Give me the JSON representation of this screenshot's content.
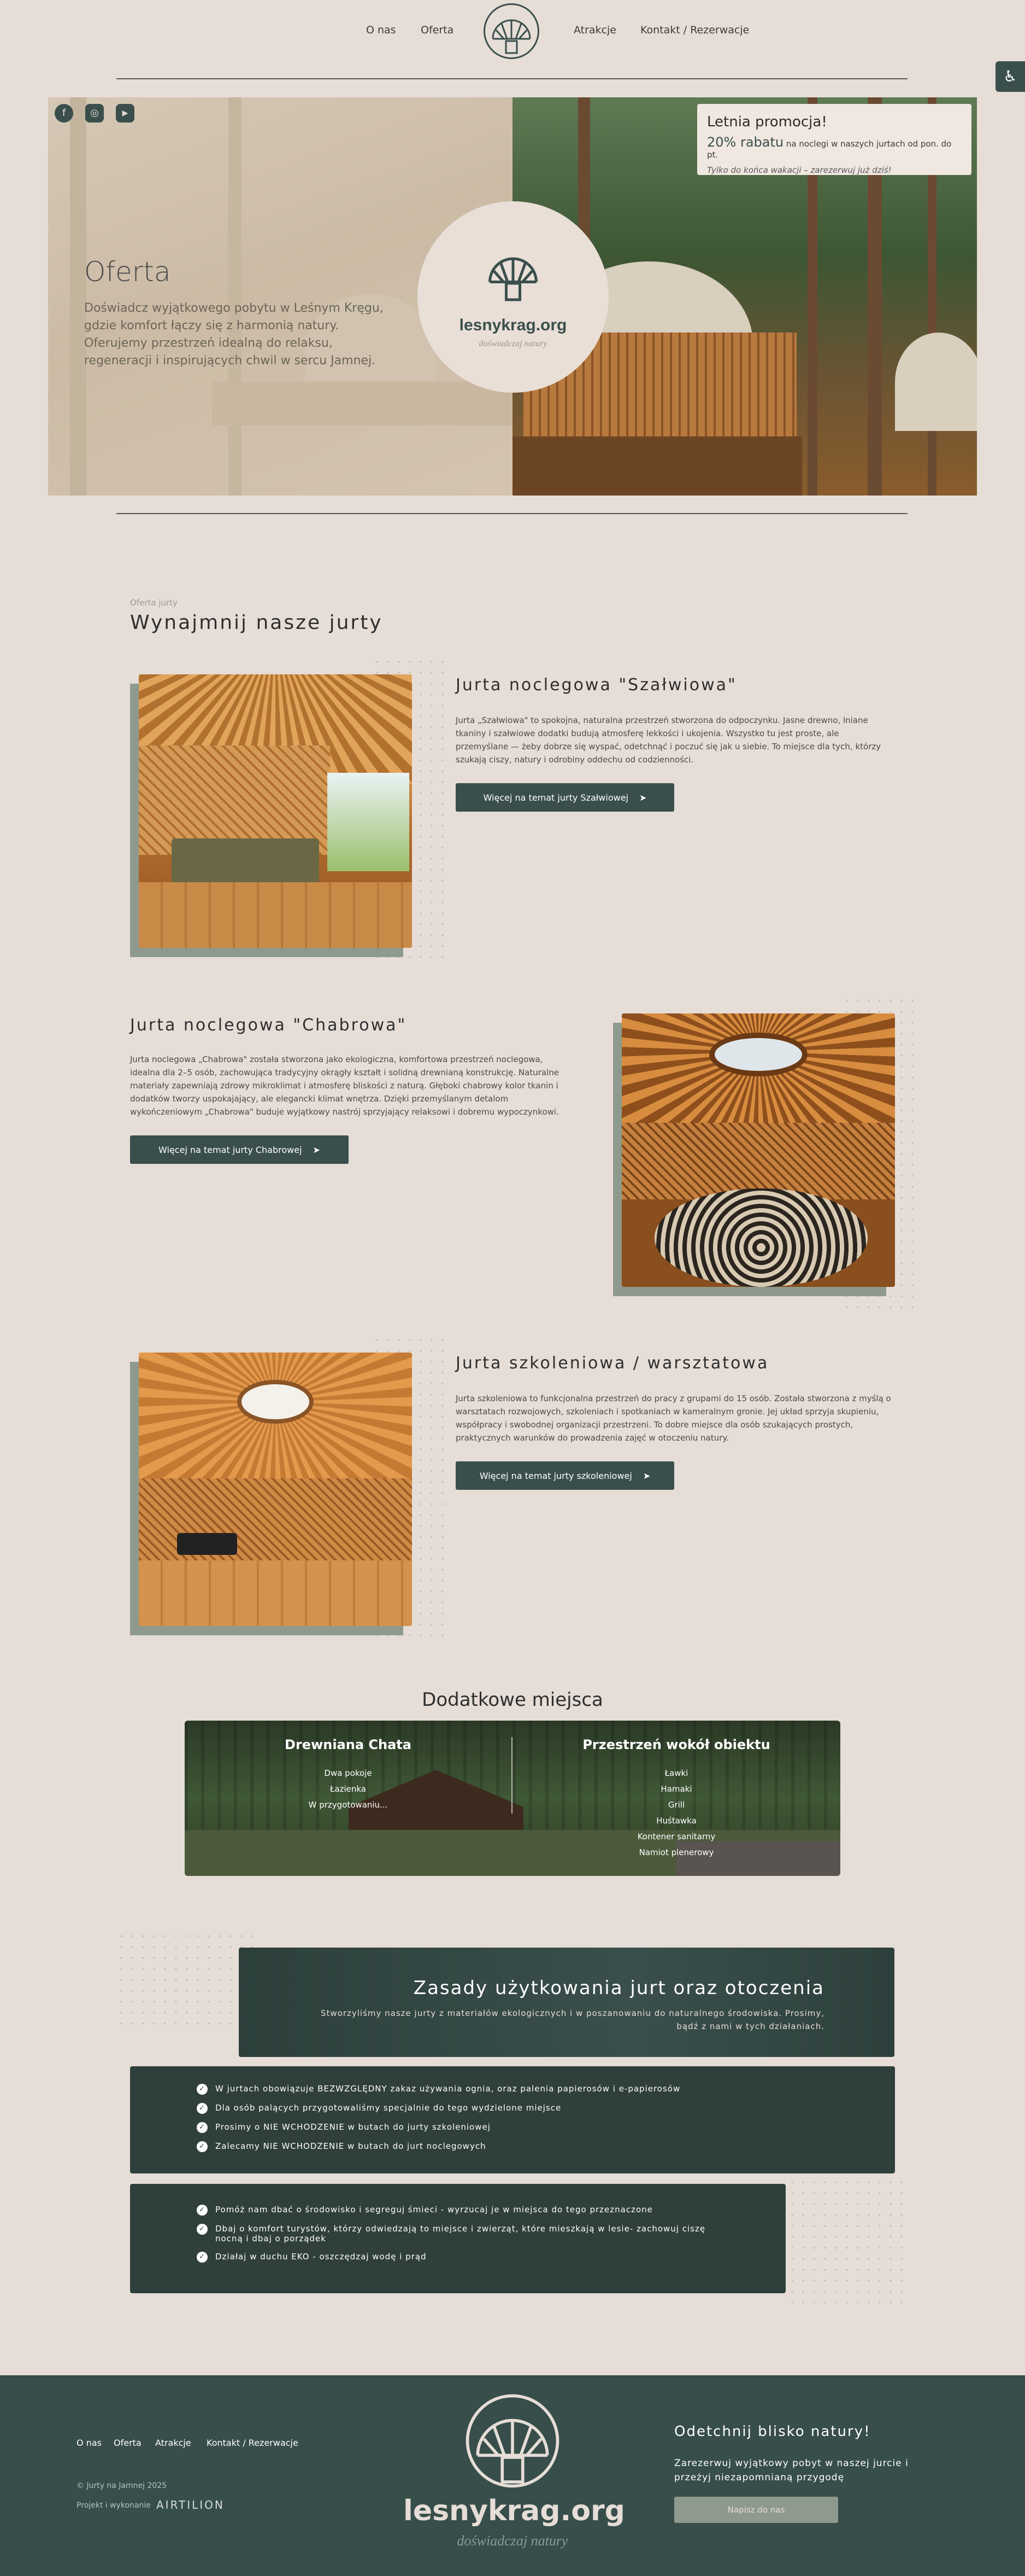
{
  "nav": {
    "items": [
      "O nas",
      "Oferta",
      "Atrakcje",
      "Kontakt / Rezerwacje"
    ]
  },
  "hero": {
    "title": "Oferta",
    "text": "Doświadcz wyjątkowego pobytu w Leśnym Kręgu, gdzie komfort łączy się z harmonią natury. Oferujemy przestrzeń idealną do relaksu, regeneracji i inspirujących chwil w sercu Jamnej.",
    "logo_name": "lesnykrag.org",
    "logo_tag": "doświadczaj natury",
    "promo": {
      "title": "Letnia promocja!",
      "highlight": "20% rabatu",
      "rest": " na noclegi w naszych jurtach od pon. do pt.",
      "note": "Tylko do końca wakacji – zarezerwuj już dziś!"
    }
  },
  "offer": {
    "eyebrow": "Oferta jurty",
    "heading": "Wynajmnij nasze jurty",
    "yurts": [
      {
        "title": "Jurta noclegowa \"Szałwiowa\"",
        "text": "Jurta „Szałwiowa\" to spokojna, naturalna przestrzeń stworzona do odpoczynku. Jasne drewno, lniane tkaniny i szałwiowe dodatki budują atmosferę lekkości i ukojenia. Wszystko tu jest proste, ale przemyślane — żeby dobrze się wyspać, odetchnąć i poczuć się jak u siebie. To miejsce dla tych, którzy szukają ciszy, natury i odrobiny oddechu od codzienności.",
        "button": "Więcej na temat jurty Szałwiowej"
      },
      {
        "title": "Jurta noclegowa \"Chabrowa\"",
        "text": "Jurta noclegowa „Chabrowa\" została stworzona jako ekologiczna, komfortowa przestrzeń noclegowa, idealna dla 2–5 osób, zachowująca tradycyjny okrągły kształt i solidną drewnianą konstrukcję. Naturalne materiały zapewniają zdrowy mikroklimat i atmosferę bliskości z naturą. Głęboki chabrowy kolor tkanin i dodatków tworzy uspokajający, ale elegancki klimat wnętrza. Dzięki przemyślanym detalom wykończeniowym „Chabrowa\" buduje wyjątkowy nastrój sprzyjający relaksowi i dobremu wypoczynkowi.",
        "button": "Więcej na temat jurty Chabrowej"
      },
      {
        "title": "Jurta szkoleniowa / warsztatowa",
        "text": "Jurta szkoleniowa to funkcjonalna przestrzeń do pracy z grupami do 15 osób. Została stworzona z myślą o warsztatach rozwojowych, szkoleniach i spotkaniach w kameralnym gronie. Jej układ sprzyja skupieniu, współpracy i swobodnej organizacji przestrzeni. To dobre miejsce dla osób szukających prostych, praktycznych warunków do prowadzenia zajęć w otoczeniu natury.",
        "button": "Więcej na temat jurty szkoleniowej"
      }
    ]
  },
  "additional": {
    "heading": "Dodatkowe miejsca",
    "left": {
      "title": "Drewniana Chata",
      "items": [
        "Dwa pokoje",
        "Łazienka",
        "W przygotowaniu..."
      ]
    },
    "right": {
      "title": "Przestrzeń wokół obiektu",
      "items": [
        "Ławki",
        "Hamaki",
        "Grill",
        "Huśtawka",
        "Kontener sanitarny",
        "Namiot plenerowy"
      ]
    }
  },
  "rules": {
    "heading": "Zasady użytkowania jurt oraz otoczenia",
    "intro": "Stworzyliśmy nasze jurty z materiałów ekologicznych i w poszanowaniu do naturalnego środowiska. Prosimy, bądź z nami w tych działaniach.",
    "group1": [
      "W jurtach obowiązuje BEZWZGLĘDNY zakaz używania ognia, oraz palenia papierosów i e-papierosów",
      "Dla osób palących przygotowaliśmy specjalnie do tego wydzielone miejsce",
      "Prosimy o NIE WCHODZENIE w butach do jurty szkoleniowej",
      "Zalecamy NIE WCHODZENIE w butach do jurt noclegowych"
    ],
    "group2": [
      "Pomóż nam dbać o środowisko i segreguj śmieci - wyrzucaj je w miejsca do tego przeznaczone",
      "Dbaj o komfort turystów, którzy odwiedzają to miejsce i zwierząt, które mieszkają w lesie- zachowuj ciszę nocną i dbaj o porządek",
      "Działaj w duchu EKO - oszczędzaj wodę i prąd"
    ]
  },
  "footer": {
    "links": [
      "O nas",
      "Oferta",
      "Atrakcje",
      "Kontakt / Rezerwacje"
    ],
    "copyright": "© Jurty na Jamnej 2025",
    "credit": "Projekt i wykonanie",
    "credit_brand": "AIRTILION",
    "logo_name": "lesnykrag.org",
    "logo_tag": "doświadczaj natury",
    "cta_title": "Odetchnij blisko natury!",
    "cta_text": "Zarezerwuj wyjątkowy pobyt w naszej jurcie i przeżyj niezapomnianą przygodę",
    "cta_button": "Napisz do nas"
  },
  "icons": [
    "facebook-icon",
    "instagram-icon",
    "youtube-icon",
    "accessibility-icon",
    "arrow-right-icon",
    "check-icon",
    "yurt-logo-icon"
  ],
  "colors": {
    "background": "#e6ddd7",
    "accent": "#3a4f4c",
    "footer": "#374e4a"
  }
}
